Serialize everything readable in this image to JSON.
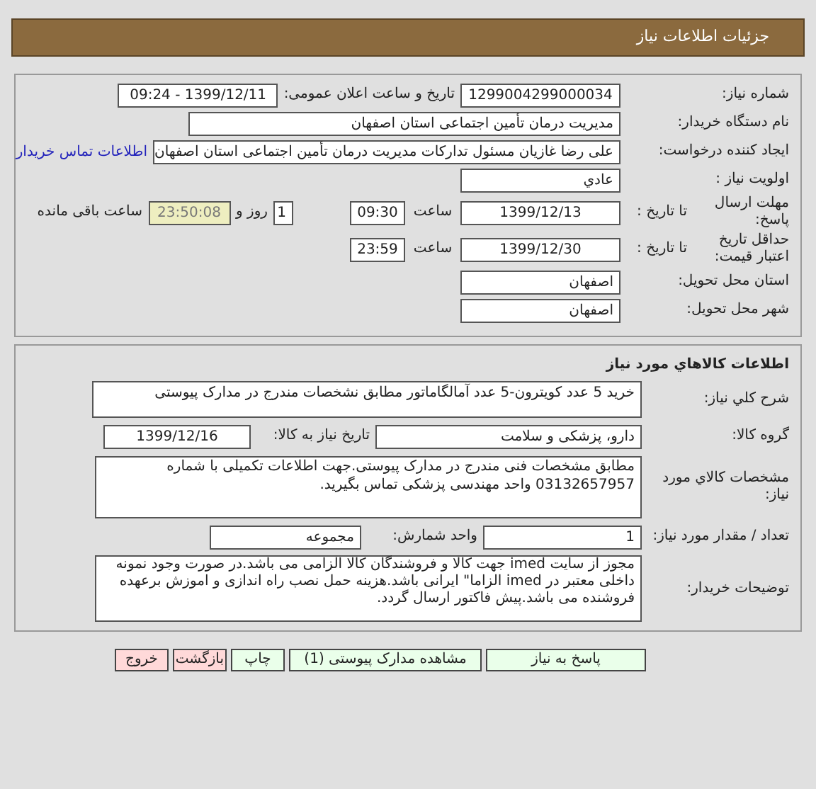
{
  "header": {
    "title": "جزئیات اطلاعات نیاز"
  },
  "need_info": {
    "need_number": {
      "label": "شماره نیاز:",
      "value": "1299004299000034"
    },
    "announce": {
      "label": "تاریخ و ساعت اعلان عمومی:",
      "value": "1399/12/11 - 09:24"
    },
    "buyer_org": {
      "label": "نام دستگاه خریدار:",
      "value": "مدیریت درمان تأمین اجتماعی استان اصفهان"
    },
    "requester": {
      "label": "ایجاد کننده درخواست:",
      "value": "علی رضا غازیان مسئول تدارکات مدیریت درمان تأمین اجتماعی استان اصفهان",
      "link": "اطلاعات تماس خریدار"
    },
    "priority": {
      "label": "اولویت نیاز :",
      "value": "عادي"
    },
    "response_deadline": {
      "label": "مهلت ارسال پاسخ:",
      "to_date_label": "تا تاریخ :",
      "date": "1399/12/13",
      "time_label": "ساعت",
      "time": "09:30",
      "days": "1",
      "days_label": "روز و",
      "remaining": "23:50:08",
      "remaining_label": "ساعت باقی مانده"
    },
    "price_validity": {
      "label": "حداقل تاریخ اعتبار قیمت:",
      "to_date_label": "تا تاریخ :",
      "date": "1399/12/30",
      "time_label": "ساعت",
      "time": "23:59"
    },
    "province": {
      "label": "استان محل تحویل:",
      "value": "اصفهان"
    },
    "city": {
      "label": "شهر محل تحویل:",
      "value": "اصفهان"
    }
  },
  "goods": {
    "title": "اطلاعات کالاهاي مورد نياز",
    "description": {
      "label": "شرح کلي نياز:",
      "value": "خرید 5 عدد کویترون-5 عدد آمالگاماتور مطابق نشخصات مندرج در مدارک پیوستی"
    },
    "group": {
      "label": "گروه کالا:",
      "value": "دارو، پزشکی و سلامت"
    },
    "need_date": {
      "label": "تاریخ نیاز به کالا:",
      "value": "1399/12/16"
    },
    "specs": {
      "label": "مشخصات کالاي مورد نياز:",
      "value": "مطابق مشخصات فنی مندرج در مدارک پیوستی.جهت اطلاعات تکمیلی با شماره 03132657957 واحد مهندسی پزشکی تماس بگیرید."
    },
    "quantity": {
      "label": "تعداد / مقدار مورد نیاز:",
      "value": "1"
    },
    "unit": {
      "label": "واحد شمارش:",
      "value": "مجموعه"
    },
    "buyer_notes": {
      "label": "توضیحات خریدار:",
      "value": "مجوز از سایت imed جهت کالا و فروشندگان کالا الزامی می باشد.در صورت وجود نمونه داخلی معتبر در imed الزاما\" ایرانی باشد.هزینه حمل نصب راه اندازی و اموزش برعهده فروشنده می باشد.پیش فاکتور ارسال گردد."
    }
  },
  "buttons": [
    {
      "label": "پاسخ به نیاز",
      "kind": "action"
    },
    {
      "label": "مشاهده مدارک پیوستی (1)",
      "kind": "action"
    },
    {
      "label": "چاپ",
      "kind": "action"
    },
    {
      "label": "بازگشت",
      "kind": "exit"
    },
    {
      "label": "خروج",
      "kind": "exit"
    }
  ]
}
